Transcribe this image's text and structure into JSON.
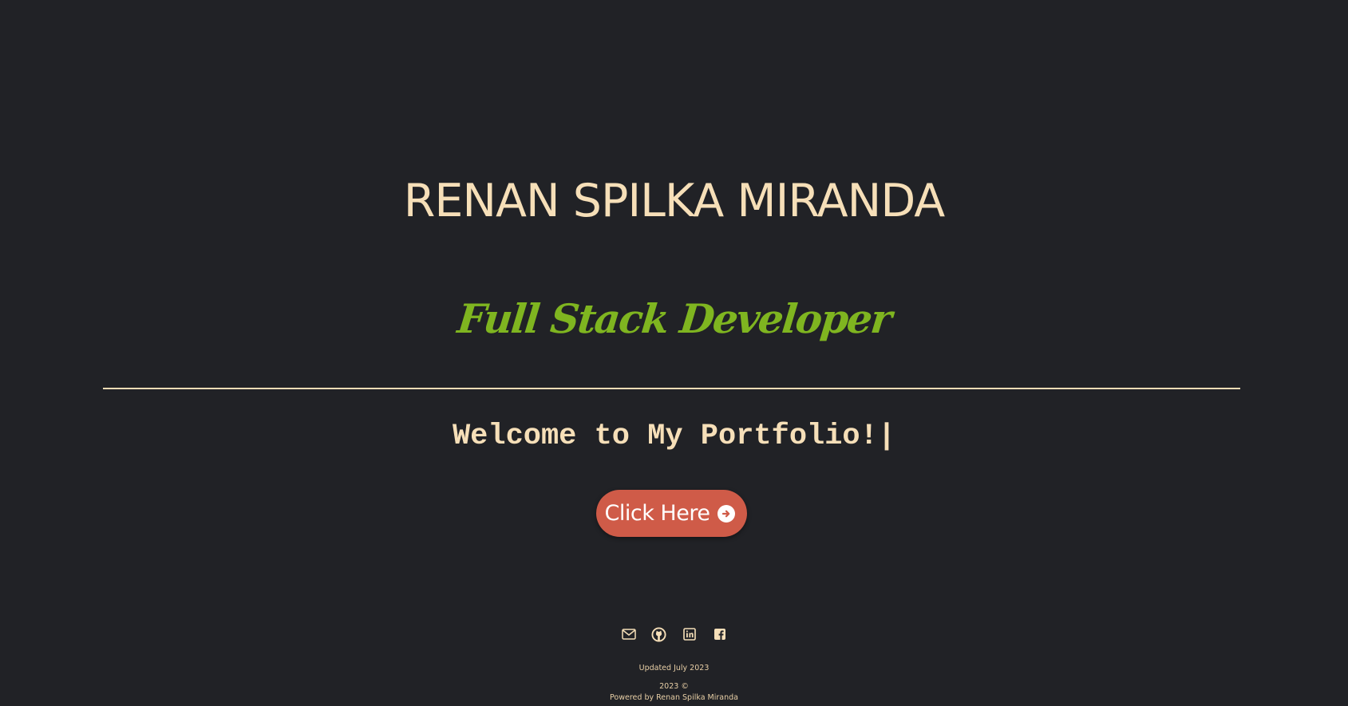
{
  "hero": {
    "name": "RENAN SPILKA MIRANDA",
    "role": "Full Stack Developer",
    "welcome": "Welcome to My Portfolio!|"
  },
  "cta": {
    "label": "Click Here",
    "icon": "arrow-right-circle-icon"
  },
  "socials": [
    {
      "name": "email",
      "icon": "mail-icon"
    },
    {
      "name": "github",
      "icon": "github-icon"
    },
    {
      "name": "linkedin",
      "icon": "linkedin-icon"
    },
    {
      "name": "facebook",
      "icon": "facebook-icon"
    }
  ],
  "footer": {
    "updated": "Updated July 2023",
    "year": "2023 ©",
    "powered": "Powered by Renan Spilka Miranda"
  },
  "colors": {
    "background": "#212226",
    "accent_cream": "#f6dfb8",
    "accent_green": "#7fb520",
    "button": "#cf5b48"
  }
}
